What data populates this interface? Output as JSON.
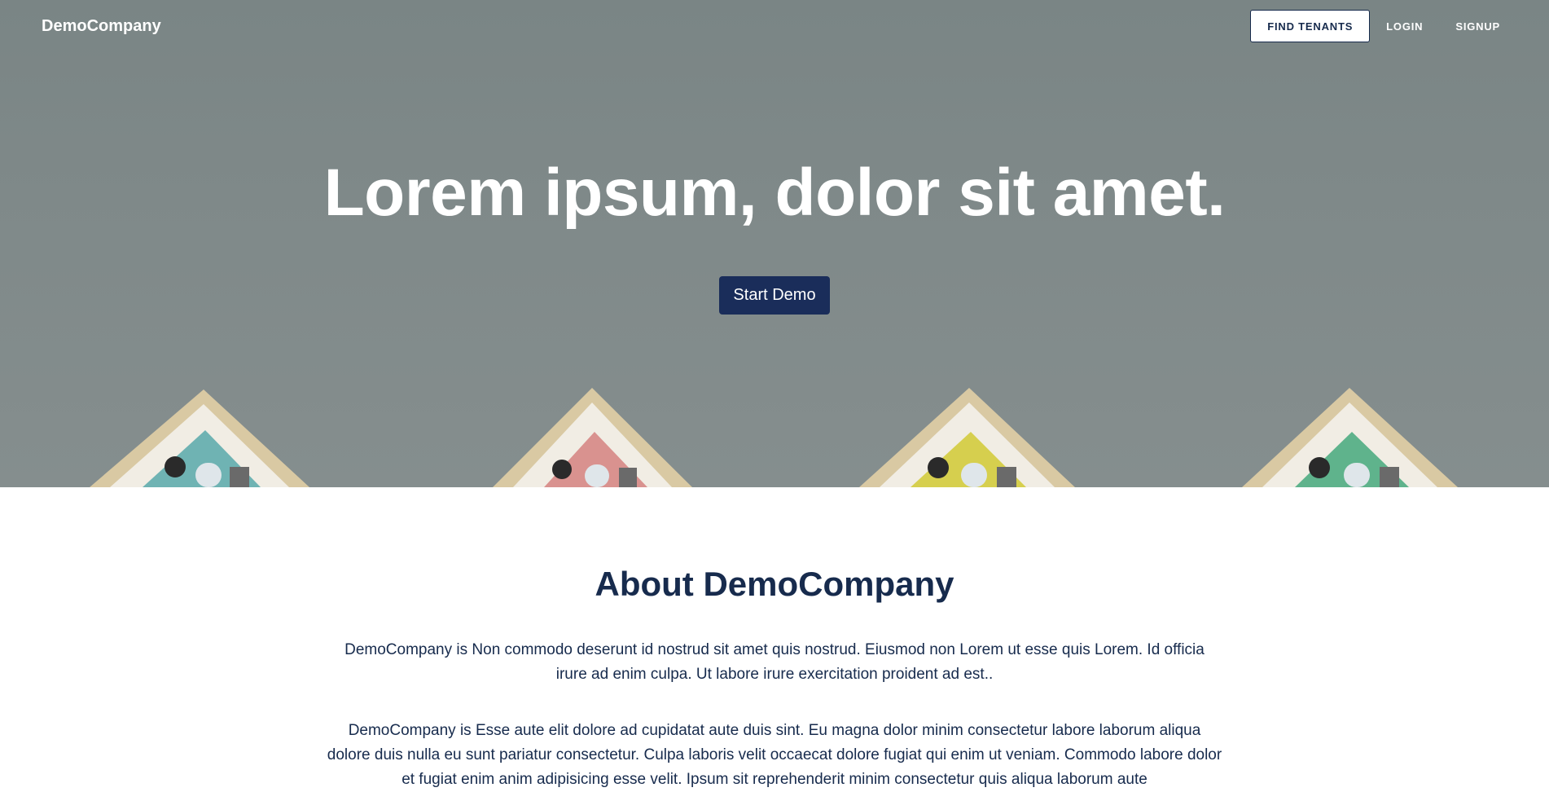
{
  "navbar": {
    "brand": "DemoCompany",
    "find_tenants": "FIND TENANTS",
    "login": "LOGIN",
    "signup": "SIGNUP"
  },
  "hero": {
    "title": "Lorem ipsum, dolor sit amet.",
    "cta": "Start Demo"
  },
  "about": {
    "heading": "About DemoCompany",
    "paragraph1": "DemoCompany is Non commodo deserunt id nostrud sit amet quis nostrud. Eiusmod non Lorem ut esse quis Lorem. Id officia irure ad enim culpa. Ut labore irure exercitation proident ad est..",
    "paragraph2": "DemoCompany is Esse aute elit dolore ad cupidatat aute duis sint. Eu magna dolor minim consectetur labore laborum aliqua dolore duis nulla eu sunt pariatur consectetur. Culpa laboris velit occaecat dolore fugiat qui enim ut veniam. Commodo labore dolor et fugiat enim anim adipisicing esse velit. Ipsum sit reprehenderit minim consectetur quis aliqua laborum aute"
  },
  "colors": {
    "primary": "#1a2d5a",
    "text": "#172b4d",
    "hero_overlay": "#7f8989"
  }
}
